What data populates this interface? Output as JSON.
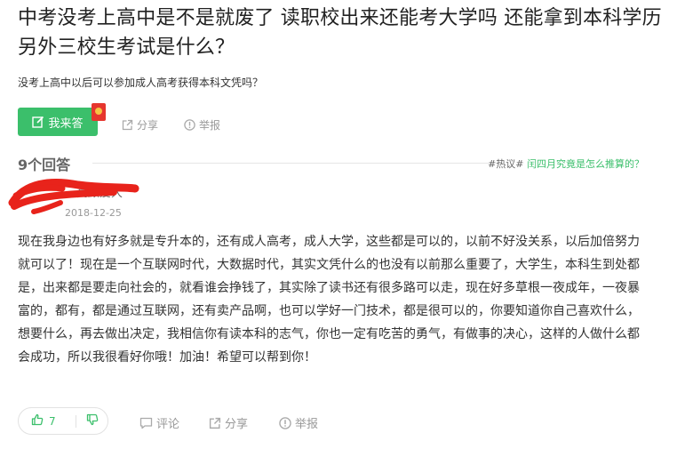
{
  "question": {
    "title": "中考没考上高中是不是就废了 读职校出来还能考大学吗 还能拿到本科学历另外三校生考试是什么？",
    "description": "没考上高中以后可以参加成人高考获得本科文凭吗？",
    "answer_button_label": "我来答",
    "share_label": "分享",
    "report_label": "举报"
  },
  "answers_section": {
    "count_label": "9个回答",
    "hot_label": "#热议#",
    "hot_link": "闰四月究竟是怎么推算的？"
  },
  "answer": {
    "username": "高顾爱大",
    "date": "2018-12-25",
    "text": "现在我身边也有好多就是专升本的，还有成人高考，成人大学，这些都是可以的，以前不好没关系，以后加倍努力就可以了！现在是一个互联网时代，大数据时代，其实文凭什么的也没有以前那么重要了，大学生，本科生到处都是，出来都是要走向社会的，就看谁会挣钱了，其实除了读书还有很多路可以走，现在好多草根一夜成年，一夜暴富的，都有，都是通过互联网，还有卖产品啊，也可以学好一门技术，都是很可以的，你要知道你自己喜欢什么，想要什么，再去做出决定，我相信你有读本科的志气，你也一定有吃苦的勇气，有做事的决心，这样的人做什么都会成功，所以我很看好你哦！加油！希望可以帮到你！",
    "like_count": "7",
    "comment_label": "评论",
    "share_label": "分享",
    "report_label": "举报"
  },
  "colors": {
    "accent_green": "#3bbf6b",
    "redaction_red": "#e8231b",
    "muted_text": "#999999"
  },
  "icons": [
    "edit-icon",
    "red-packet-icon",
    "share-icon",
    "report-icon",
    "thumbs-up-icon",
    "thumbs-down-icon",
    "comment-icon"
  ]
}
